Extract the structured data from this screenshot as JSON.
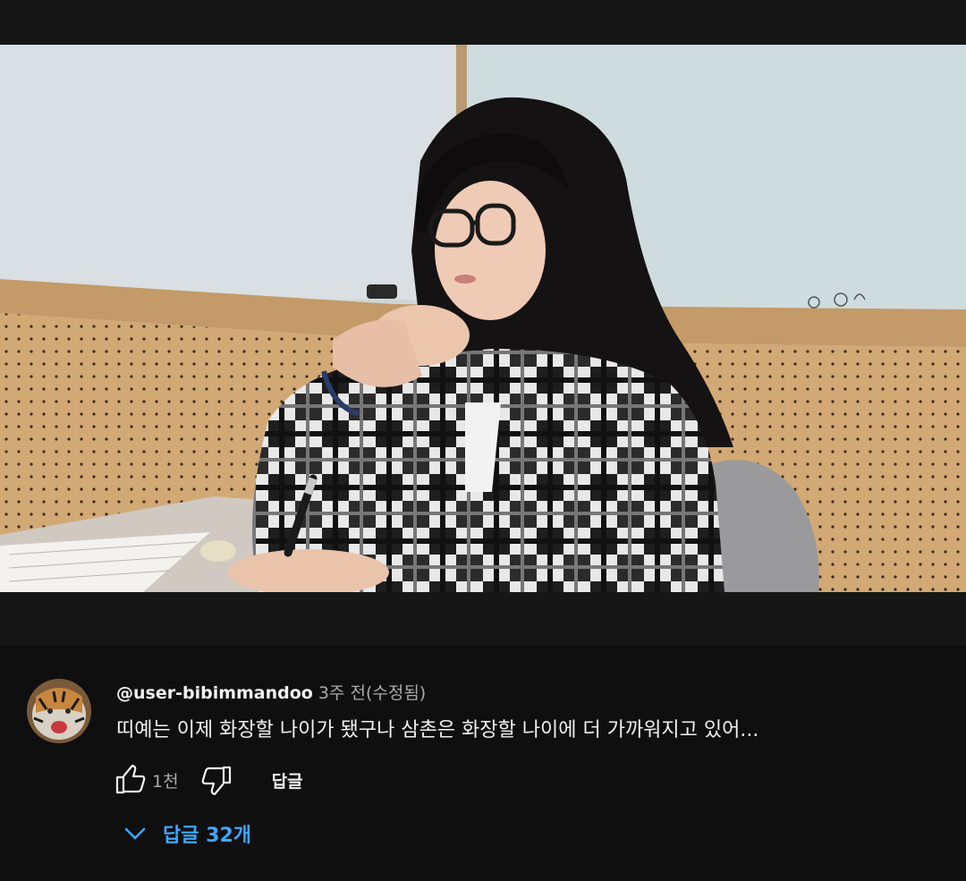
{
  "comment": {
    "author": "@user-bibimmandoo",
    "time": "3주 전(수정됨)",
    "text": "띠예는 이제 화장할 나이가 됐구나 삼촌은 화장할 나이에 더 가까워지고 있어...",
    "like_count": "1천",
    "reply_label": "답글",
    "replies_label": "답글 32개"
  },
  "colors": {
    "accent": "#3ea6ff",
    "background": "#0f0f0f",
    "secondary_text": "#aaaaaa"
  },
  "icons": {
    "like": "thumb-up-icon",
    "dislike": "thumb-down-icon",
    "expand": "chevron-down-icon"
  }
}
